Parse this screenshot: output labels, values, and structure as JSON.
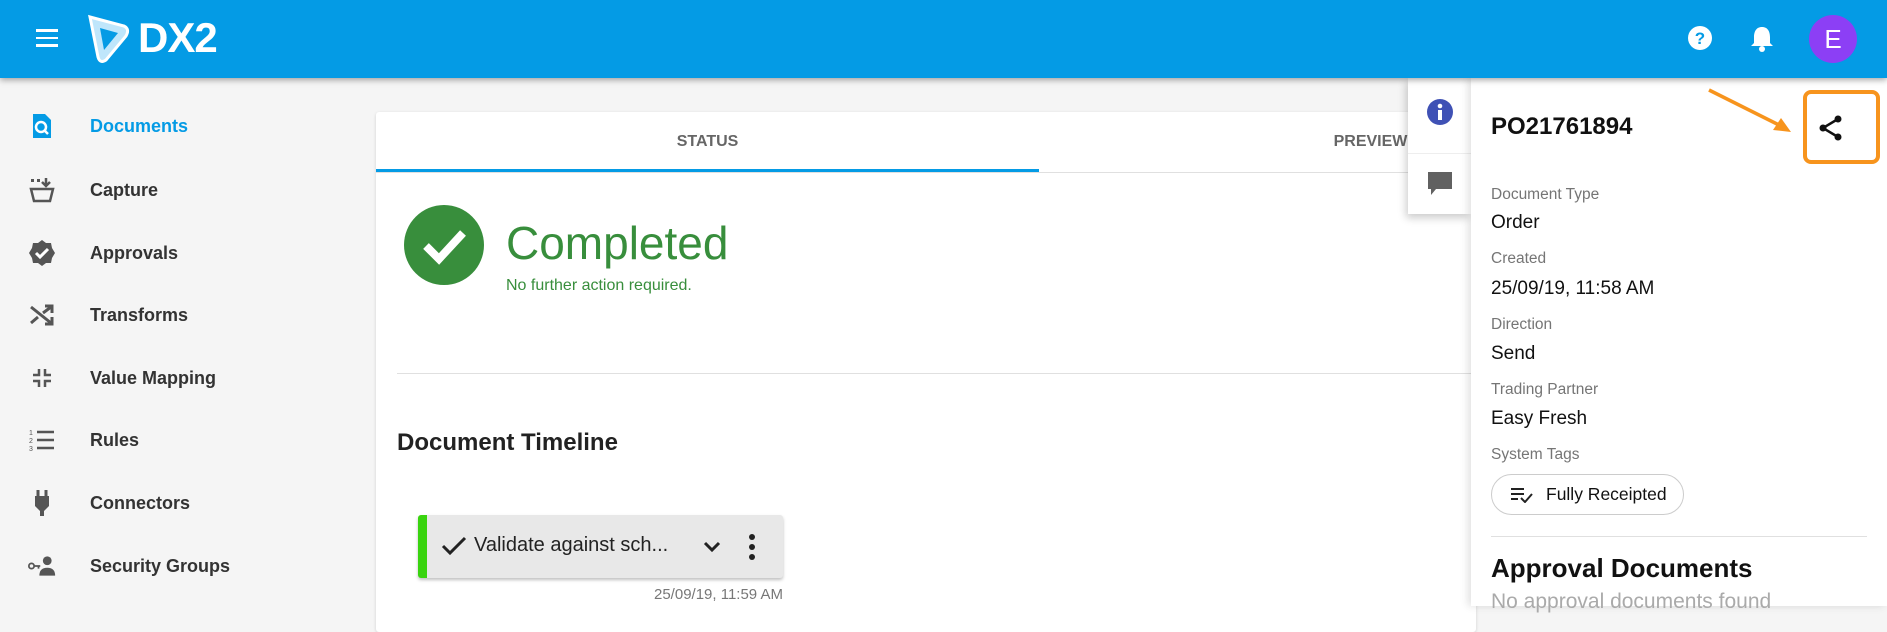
{
  "header": {
    "brand": "DX2",
    "avatar_initial": "E",
    "avatar_color": "#8c3ff5",
    "bg": "#049be5"
  },
  "sidebar": {
    "items": [
      {
        "label": "Documents",
        "icon": "document-search-icon",
        "active": true
      },
      {
        "label": "Capture",
        "icon": "capture-icon"
      },
      {
        "label": "Approvals",
        "icon": "verified-badge-icon"
      },
      {
        "label": "Transforms",
        "icon": "shuffle-icon"
      },
      {
        "label": "Value Mapping",
        "icon": "compress-icon"
      },
      {
        "label": "Rules",
        "icon": "numbered-list-icon"
      },
      {
        "label": "Connectors",
        "icon": "plug-icon"
      },
      {
        "label": "Security Groups",
        "icon": "key-user-icon"
      }
    ]
  },
  "tabs": [
    {
      "label": "STATUS",
      "active": true
    },
    {
      "label": "PREVIEW"
    }
  ],
  "status": {
    "title": "Completed",
    "subtitle": "No further action required.",
    "color": "#388e3c"
  },
  "timeline": {
    "heading": "Document Timeline",
    "items": [
      {
        "label": "Validate against sch...",
        "time": "25/09/19, 11:59 AM",
        "accent": "#39d40f"
      }
    ]
  },
  "panel": {
    "title": "PO21761894",
    "fields": [
      {
        "label": "Document Type",
        "value": "Order"
      },
      {
        "label": "Created",
        "value": "25/09/19, 11:58 AM"
      },
      {
        "label": "Direction",
        "value": "Send"
      },
      {
        "label": "Trading Partner",
        "value": "Easy Fresh"
      }
    ],
    "tags_label": "System Tags",
    "tags": [
      "Fully Receipted"
    ],
    "approval_heading": "Approval Documents",
    "approval_empty": "No approval documents found"
  },
  "annotation_color": "#f7941d"
}
